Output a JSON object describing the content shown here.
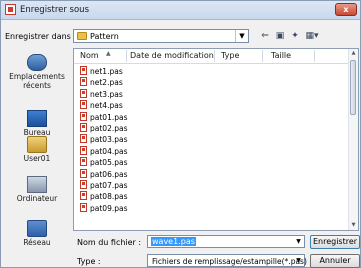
{
  "window": {
    "title": "Enregistrer sous",
    "close_label": "x"
  },
  "lookin": {
    "label": "Enregistrer dans :",
    "value": "Pattern"
  },
  "toolbar": {
    "back_icon": "back-arrow-icon",
    "up_icon": "up-folder-icon",
    "newfolder_icon": "new-folder-icon",
    "view_icon": "view-menu-icon"
  },
  "places": [
    {
      "label": "Emplacements récents",
      "icon": "recent-places-icon"
    },
    {
      "label": "Bureau",
      "icon": "desktop-icon"
    },
    {
      "label": "User01",
      "icon": "user-folder-icon"
    },
    {
      "label": "Ordinateur",
      "icon": "computer-icon"
    },
    {
      "label": "Réseau",
      "icon": "network-icon"
    }
  ],
  "columns": {
    "name": "Nom",
    "date": "Date de modification",
    "type": "Type",
    "size": "Taille"
  },
  "files": [
    "net1.pas",
    "net2.pas",
    "net3.pas",
    "net4.pas",
    "pat01.pas",
    "pat02.pas",
    "pat03.pas",
    "pat04.pas",
    "pat05.pas",
    "pat06.pas",
    "pat07.pas",
    "pat08.pas",
    "pat09.pas"
  ],
  "filename": {
    "label": "Nom du fichier :",
    "value": "wave1.pas"
  },
  "filetype": {
    "label": "Type :",
    "value": "Fichiers de remplissage/estampille(*.pas)"
  },
  "buttons": {
    "save": "Enregistrer",
    "cancel": "Annuler"
  }
}
